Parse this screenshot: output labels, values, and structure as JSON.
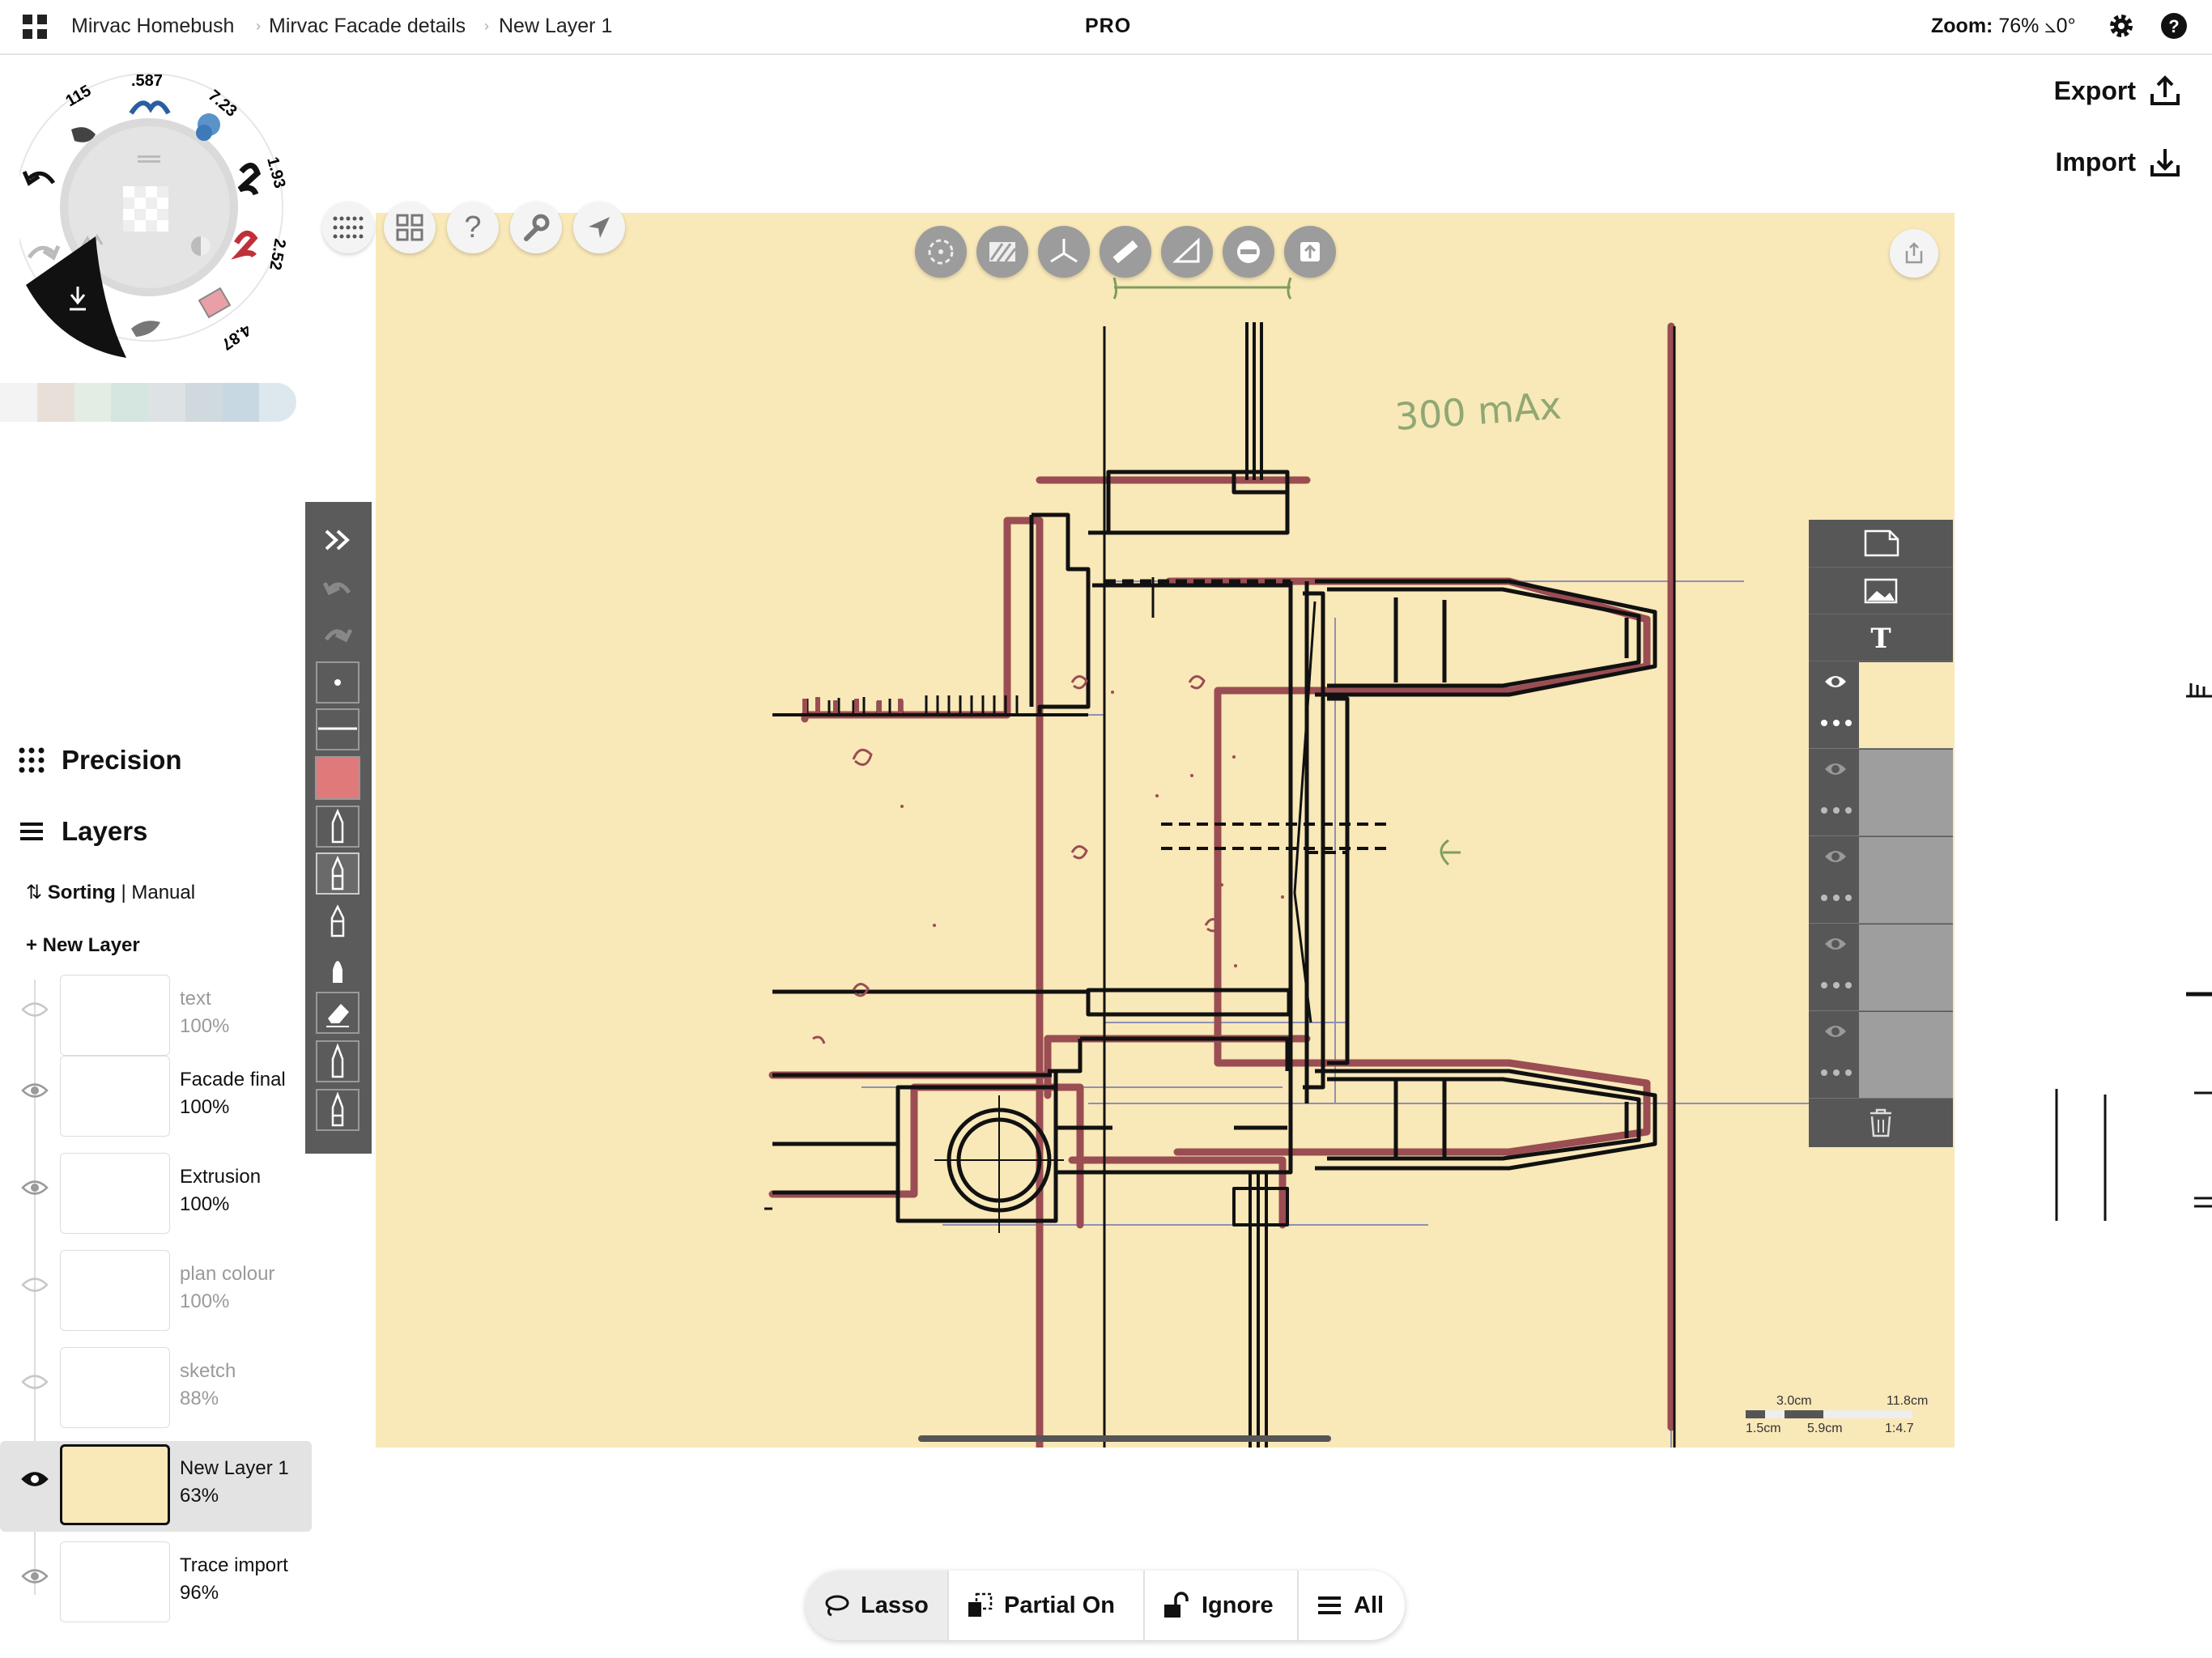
{
  "topbar": {
    "breadcrumb": [
      "Mirvac Homebush",
      "Mirvac Facade details",
      "New Layer 1"
    ],
    "pro_label": "PRO",
    "zoom_label": "Zoom:",
    "zoom_value": "76% ⦣0°"
  },
  "actions": {
    "export_label": "Export",
    "import_label": "Import"
  },
  "wheel": {
    "sizes": [
      "115",
      ".587",
      "7.23",
      "1.93",
      "2.52",
      "4.87"
    ]
  },
  "palette": [
    "#f3f3f3",
    "#e9dfd9",
    "#e3ede4",
    "#d5e5df",
    "#dde3e4",
    "#d0d9dd",
    "#c8d8e3",
    "#dde8ee"
  ],
  "sidebar": {
    "precision_label": "Precision",
    "layers_label": "Layers",
    "sorting_label": "Sorting",
    "sorting_mode": "| Manual",
    "new_layer_label": "+ New Layer",
    "layers": [
      {
        "name": "text",
        "opacity": "100%"
      },
      {
        "name": "Facade final",
        "opacity": "100%"
      },
      {
        "name": "Extrusion",
        "opacity": "100%"
      },
      {
        "name": "plan colour",
        "opacity": "100%"
      },
      {
        "name": "sketch",
        "opacity": "88%"
      },
      {
        "name": "New Layer 1",
        "opacity": "63%"
      },
      {
        "name": "Trace import",
        "opacity": "96%"
      }
    ]
  },
  "canvas": {
    "color": "#f9e8b8",
    "annotation": "300 mAx",
    "scale": {
      "top_left": "3.0cm",
      "top_right": "11.8cm",
      "bottom_a": "1.5cm",
      "bottom_b": "5.9cm",
      "ratio": "1:4.7"
    }
  },
  "bottombar": {
    "lasso": "Lasso",
    "partial": "Partial On",
    "ignore": "Ignore",
    "all": "All"
  },
  "colors": {
    "active_brush": "#e07a7a",
    "wall_outline": "#9a4d52"
  }
}
